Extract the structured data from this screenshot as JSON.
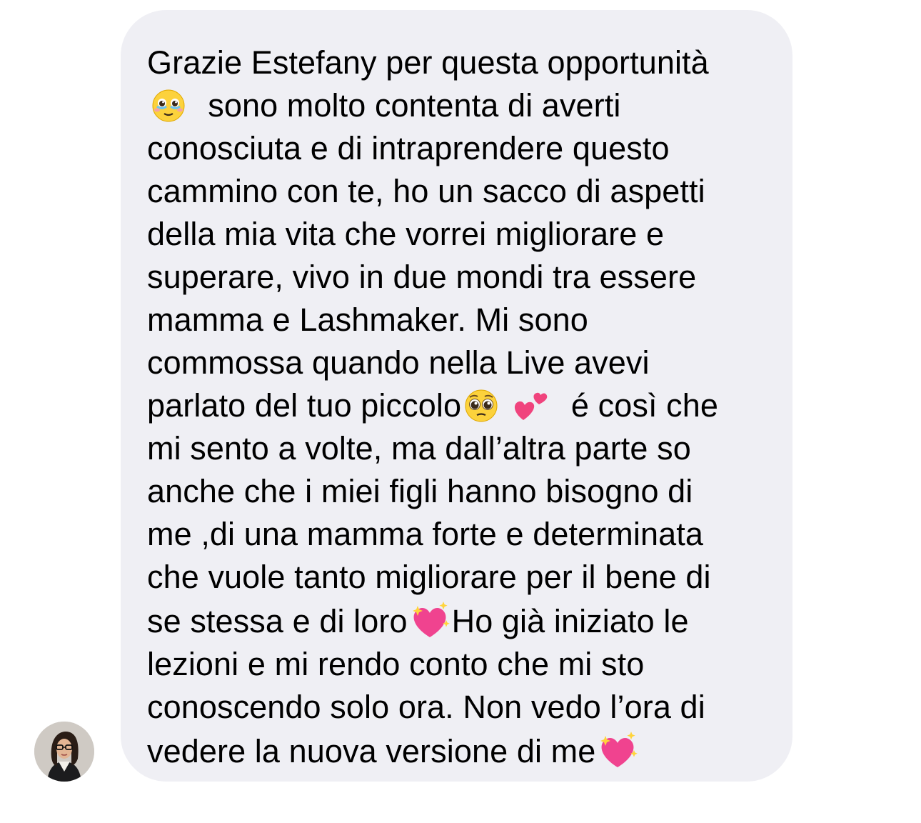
{
  "conversation": {
    "message": {
      "lines": [
        "Grazie Estefany per questa opportunità",
        "sono molto contenta di averti",
        "conosciuta e di intraprendere questo",
        "cammino con te, ho un sacco di aspetti",
        "della mia vita che vorrei migliorare e",
        "superare, vivo in due mondi tra essere",
        "mamma e Lashmaker. Mi sono",
        "commossa quando nella Live avevi",
        "parlato del tuo piccolo",
        "é così che",
        "mi sento a volte, ma dall’altra parte so",
        "anche che i miei figli hanno bisogno di",
        "me ,di una mamma forte e determinata",
        "che vuole tanto migliorare per il bene di",
        "se stessa e di loro",
        "Ho già iniziato le",
        "lezioni e mi rendo conto che mi sto",
        "conoscendo solo ora. Non vedo l’ora di",
        "vedere la nuova versione di me"
      ],
      "emojis": [
        "face-holding-back-tears-emoji",
        "pleading-face-emoji",
        "two-hearts-emoji",
        "sparkling-heart-emoji",
        "sparkling-heart-emoji"
      ]
    },
    "sender": {
      "avatar_icon": "profile-photo-avatar"
    },
    "colors": {
      "bubble_background": "#efeff4",
      "text": "#000000",
      "background": "#ffffff"
    }
  }
}
